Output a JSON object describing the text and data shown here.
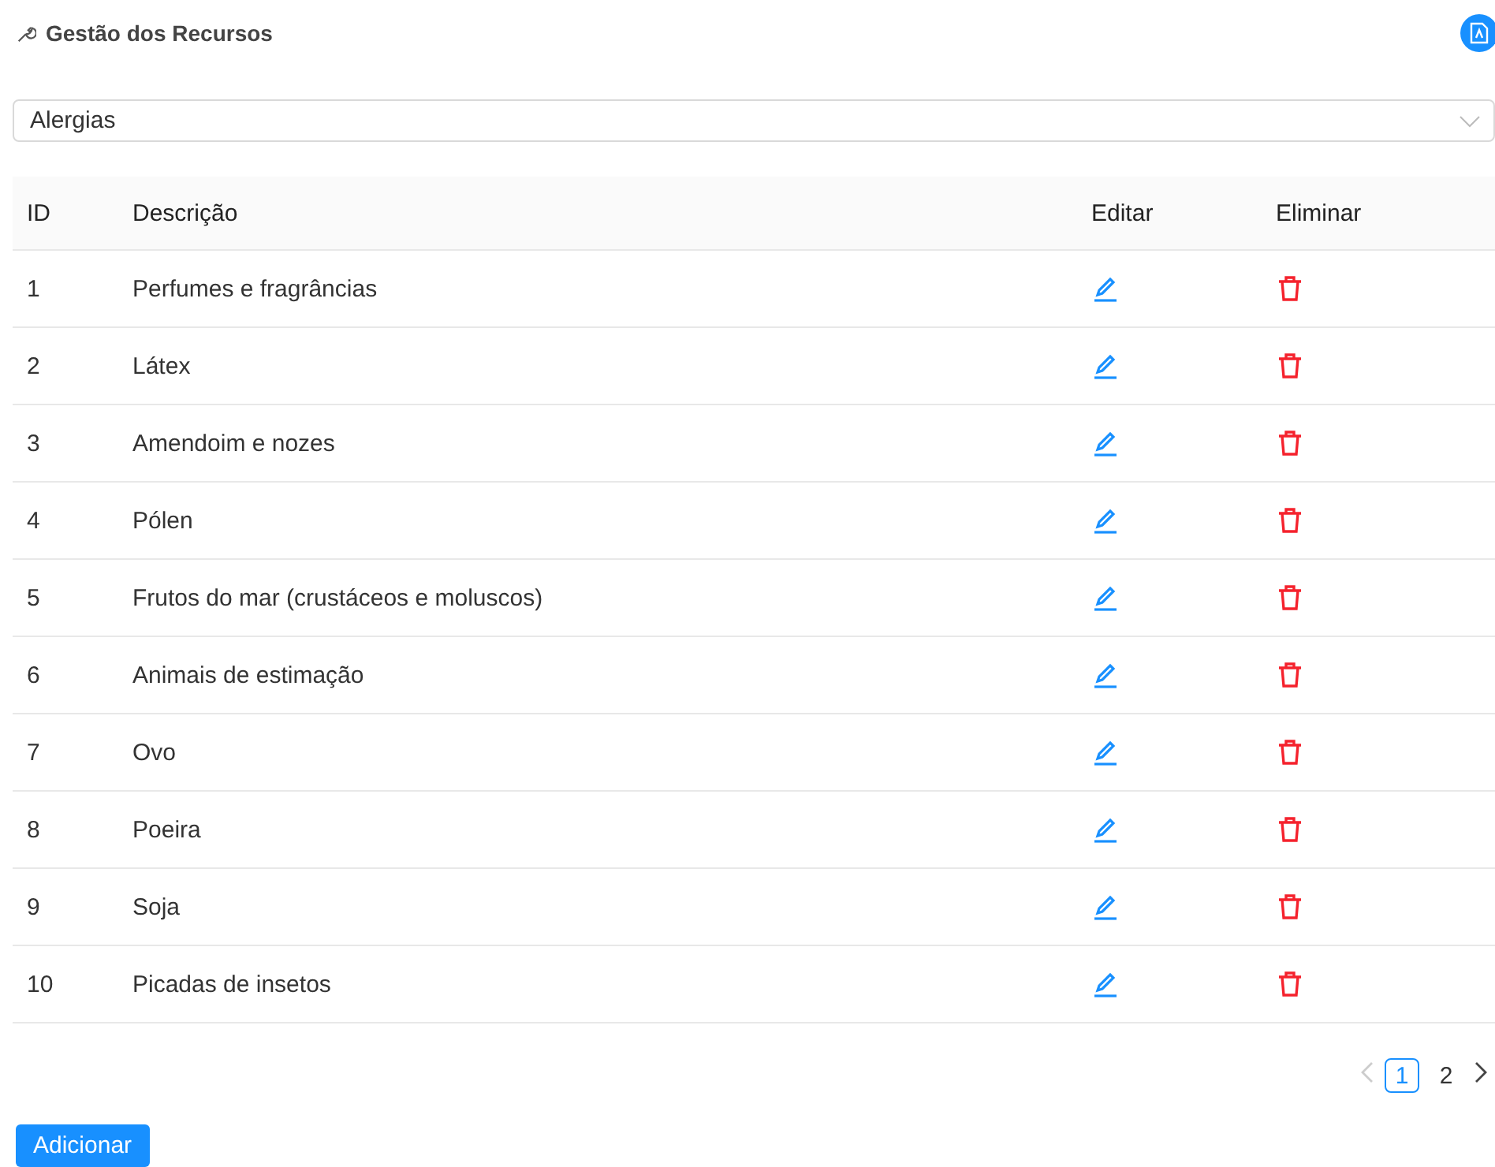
{
  "header": {
    "title": "Gestão dos Recursos"
  },
  "select": {
    "value": "Alergias"
  },
  "table": {
    "columns": [
      "ID",
      "Descrição",
      "Editar",
      "Eliminar"
    ],
    "rows": [
      {
        "id": "1",
        "description": "Perfumes e fragrâncias"
      },
      {
        "id": "2",
        "description": "Látex"
      },
      {
        "id": "3",
        "description": "Amendoim e nozes"
      },
      {
        "id": "4",
        "description": "Pólen"
      },
      {
        "id": "5",
        "description": "Frutos do mar (crustáceos e moluscos)"
      },
      {
        "id": "6",
        "description": "Animais de estimação"
      },
      {
        "id": "7",
        "description": "Ovo"
      },
      {
        "id": "8",
        "description": "Poeira"
      },
      {
        "id": "9",
        "description": "Soja"
      },
      {
        "id": "10",
        "description": "Picadas de insetos"
      }
    ]
  },
  "pagination": {
    "prev_disabled": true,
    "next_disabled": false,
    "pages": [
      {
        "label": "1",
        "selected": true
      },
      {
        "label": "2",
        "selected": false
      }
    ]
  },
  "add_button": "Adicionar"
}
